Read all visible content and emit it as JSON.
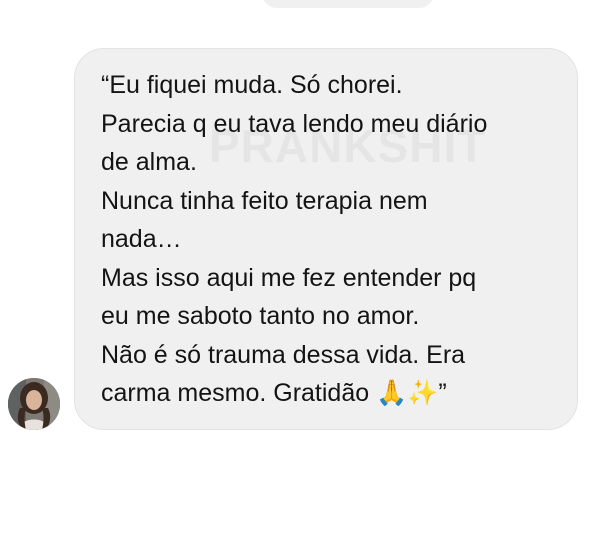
{
  "conversation": {
    "message": {
      "lines": [
        "“Eu fiquei muda. Só chorei.",
        "Parecia q eu tava lendo meu diário",
        "de alma.",
        "Nunca tinha feito terapia nem",
        "nada…",
        "Mas isso aqui me fez entender pq",
        "eu me saboto tanto no amor.",
        "Não é só trauma dessa vida. Era",
        "carma mesmo. Gratidão 🙏✨”"
      ],
      "watermark": "PRANKSHIT"
    }
  },
  "colors": {
    "bubble_background": "#f0f0f0",
    "text": "#141414",
    "page_background": "#ffffff"
  }
}
